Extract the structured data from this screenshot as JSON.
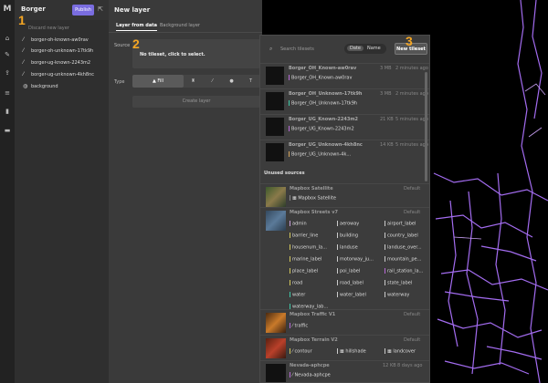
{
  "rail": {
    "logo": "M",
    "icons": [
      "home-icon",
      "paint-icon",
      "upload-icon",
      "database-icon",
      "chart-icon",
      "folder-icon"
    ]
  },
  "layers_panel": {
    "title": "Borger",
    "publish_label": "Publish",
    "discard_label": "Discard new layer",
    "layers": [
      {
        "name": "borger-oh-known-aw0rav"
      },
      {
        "name": "borger-oh-unknown-17tk9h"
      },
      {
        "name": "borger-ug-known-2243m2"
      },
      {
        "name": "borger-ug-unknown-4kh8nc"
      },
      {
        "name": "background"
      }
    ]
  },
  "new_layer": {
    "title": "New layer",
    "tabs": [
      "Layer from data",
      "Background layer"
    ],
    "source_label": "Source",
    "source_empty": "No tileset, click to select.",
    "type_label": "Type",
    "types": [
      "Fill",
      "",
      "",
      "",
      "T"
    ],
    "create_label": "Create layer"
  },
  "dropdown": {
    "search_placeholder": "Search tilesets",
    "sort_options": [
      "Date",
      "Name"
    ],
    "new_tileset_label": "New tileset",
    "tilesets": [
      {
        "name": "Borger_OH_Known-aw0rav",
        "size": "3 MB",
        "age": "2 minutes ago",
        "layer": "Borger_OH_Known-aw0rav",
        "color": "#b96ad9"
      },
      {
        "name": "Borger_OH_Unknown-17tk9h",
        "size": "3 MB",
        "age": "2 minutes ago",
        "layer": "Borger_OH_Unknown-17tk9h",
        "color": "#3ec9a7"
      },
      {
        "name": "Borger_UG_Known-2243m2",
        "size": "21 KB",
        "age": "5 minutes ago",
        "layer": "Borger_UG_Known-2243m2",
        "color": "#b96ad9"
      },
      {
        "name": "Borger_UG_Unknown-4kh8nc",
        "size": "14 KB",
        "age": "5 minutes ago",
        "layer": "Borger_UG_Unknown-4k...",
        "color": "#d4a45c"
      }
    ],
    "unused_label": "Unused sources",
    "sources": [
      {
        "name": "Mapbox Satellite",
        "default": "Default",
        "layers": [
          {
            "label": "Mapbox Satellite",
            "color": "#888"
          }
        ]
      },
      {
        "name": "Mapbox Streets v7",
        "default": "Default",
        "layers": [
          {
            "label": "admin",
            "color": "#c9a0dc"
          },
          {
            "label": "aeroway",
            "color": "#ccc"
          },
          {
            "label": "airport_label",
            "color": "#ccc"
          },
          {
            "label": "barrier_line",
            "color": "#d4c85c"
          },
          {
            "label": "building",
            "color": "#ccc"
          },
          {
            "label": "country_label",
            "color": "#ccc"
          },
          {
            "label": "housenum_la...",
            "color": "#d4c85c"
          },
          {
            "label": "landuse",
            "color": "#ccc"
          },
          {
            "label": "landuse_over...",
            "color": "#ccc"
          },
          {
            "label": "marine_label",
            "color": "#d4c85c"
          },
          {
            "label": "motorway_ju...",
            "color": "#ccc"
          },
          {
            "label": "mountain_pe...",
            "color": "#ccc"
          },
          {
            "label": "place_label",
            "color": "#d4c85c"
          },
          {
            "label": "poi_label",
            "color": "#ccc"
          },
          {
            "label": "rail_station_la...",
            "color": "#b96ad9"
          },
          {
            "label": "road",
            "color": "#d4c85c"
          },
          {
            "label": "road_label",
            "color": "#ccc"
          },
          {
            "label": "state_label",
            "color": "#ccc"
          },
          {
            "label": "water",
            "color": "#3ec9a7"
          },
          {
            "label": "water_label",
            "color": "#ccc"
          },
          {
            "label": "waterway",
            "color": "#ccc"
          },
          {
            "label": "waterway_lab...",
            "color": "#3ec9a7"
          }
        ]
      },
      {
        "name": "Mapbox Traffic V1",
        "default": "Default",
        "layers": [
          {
            "label": "traffic",
            "color": "#b96ad9"
          }
        ]
      },
      {
        "name": "Mapbox Terrain V2",
        "default": "Default",
        "layers": [
          {
            "label": "contour",
            "color": "#d4c85c"
          },
          {
            "label": "hillshade",
            "color": "#ccc"
          },
          {
            "label": "landcover",
            "color": "#ccc"
          }
        ]
      },
      {
        "name": "Nevada-aphcpe",
        "default": "",
        "size": "12 KB",
        "age": "8 days ago",
        "layers": [
          {
            "label": "Nevada-aphcpe",
            "color": "#b96ad9"
          }
        ]
      }
    ]
  },
  "callouts": [
    "1",
    "2",
    "3"
  ],
  "colors": {
    "accent": "#7a6de0",
    "callout": "#f5a623",
    "route": "#a36cf0"
  }
}
